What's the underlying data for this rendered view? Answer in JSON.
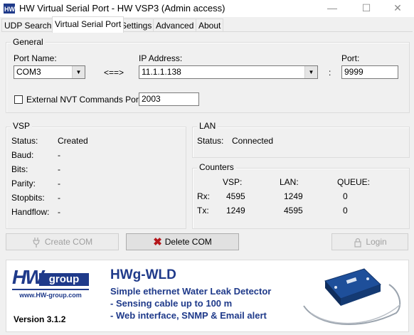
{
  "window": {
    "title": "HW Virtual Serial Port - HW VSP3 (Admin access)"
  },
  "tabs": [
    "UDP Search",
    "Virtual Serial Port",
    "Settings",
    "Advanced",
    "About"
  ],
  "general": {
    "label": "General",
    "port_name_label": "Port Name:",
    "port_name_value": "COM3",
    "arrow_text": "<==>",
    "ip_label": "IP Address:",
    "ip_value": "11.1.1.138",
    "colon": ":",
    "port_label": "Port:",
    "port_value": "9999",
    "nvt_label": "External NVT Commands Port:",
    "nvt_value": "2003"
  },
  "vsp": {
    "label": "VSP",
    "rows": [
      {
        "label": "Status:",
        "value": "Created"
      },
      {
        "label": "Baud:",
        "value": "-"
      },
      {
        "label": "Bits:",
        "value": "-"
      },
      {
        "label": "Parity:",
        "value": "-"
      },
      {
        "label": "Stopbits:",
        "value": "-"
      },
      {
        "label": "Handflow:",
        "value": "-"
      }
    ]
  },
  "lan": {
    "label": "LAN",
    "status_label": "Status:",
    "status_value": "Connected"
  },
  "counters": {
    "label": "Counters",
    "headers": [
      "VSP:",
      "LAN:",
      "QUEUE:"
    ],
    "rows": [
      {
        "label": "Rx:",
        "vsp": "4595",
        "lan": "1249",
        "queue": "0"
      },
      {
        "label": "Tx:",
        "vsp": "1249",
        "lan": "4595",
        "queue": "0"
      }
    ]
  },
  "buttons": {
    "create": "Create COM",
    "delete": "Delete COM",
    "login": "Login"
  },
  "banner": {
    "logo_hw": "HW",
    "logo_group": "group",
    "logo_url": "www.HW-group.com",
    "version": "Version  3.1.2",
    "product": "HWg-WLD",
    "subtitle": "Simple ethernet Water Leak Detector",
    "bullet1": "- Sensing cable up to 100 m",
    "bullet2": "- Web interface, SNMP & Email alert"
  },
  "colors": {
    "brand_blue": "#1f3a8a",
    "delete_red": "#b4161b"
  }
}
